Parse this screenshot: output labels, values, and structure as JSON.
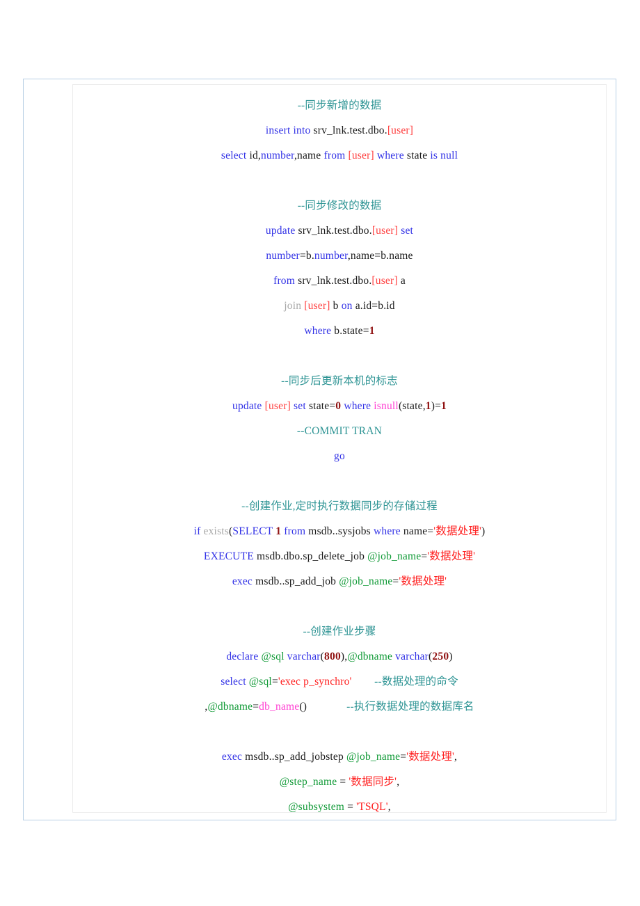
{
  "document": {
    "type": "sql-code-listing",
    "language": "T-SQL",
    "alignment": "center",
    "colors": {
      "page_border": "#b8cfe5",
      "content_border": "#ececec",
      "background": "#ffffff",
      "plain": "#1a1a1a",
      "keyword": "#3232e6",
      "comment": "#2e9494",
      "bracket": "#ff4040",
      "string": "#ff2020",
      "number": "#8f1111",
      "variable": "#119a37",
      "function": "#ff3fd2",
      "dim": "#a8a8a8"
    }
  },
  "lines": [
    {
      "id": "l1",
      "tokens": [
        {
          "t": "--同步新增的数据",
          "c": "comment"
        }
      ]
    },
    {
      "id": "l2",
      "tokens": [
        {
          "t": "insert into",
          "c": "keyword"
        },
        {
          "t": " srv_lnk.test.dbo.",
          "c": "plain"
        },
        {
          "t": "[user]",
          "c": "bracket"
        }
      ]
    },
    {
      "id": "l3",
      "tokens": [
        {
          "t": "select",
          "c": "keyword"
        },
        {
          "t": " id,",
          "c": "plain"
        },
        {
          "t": "number",
          "c": "keyword"
        },
        {
          "t": ",name ",
          "c": "plain"
        },
        {
          "t": "from",
          "c": "keyword"
        },
        {
          "t": " ",
          "c": "plain"
        },
        {
          "t": "[user]",
          "c": "bracket"
        },
        {
          "t": " ",
          "c": "plain"
        },
        {
          "t": "where",
          "c": "keyword"
        },
        {
          "t": " state ",
          "c": "plain"
        },
        {
          "t": "is null",
          "c": "keyword"
        }
      ]
    },
    {
      "id": "l4",
      "tokens": []
    },
    {
      "id": "l5",
      "tokens": [
        {
          "t": "--同步修改的数据",
          "c": "comment"
        }
      ]
    },
    {
      "id": "l6",
      "tokens": [
        {
          "t": "update",
          "c": "keyword"
        },
        {
          "t": " srv_lnk.test.dbo.",
          "c": "plain"
        },
        {
          "t": "[user]",
          "c": "bracket"
        },
        {
          "t": " ",
          "c": "plain"
        },
        {
          "t": "set",
          "c": "keyword"
        }
      ]
    },
    {
      "id": "l7",
      "tokens": [
        {
          "t": "number",
          "c": "keyword"
        },
        {
          "t": "=b.",
          "c": "plain"
        },
        {
          "t": "number",
          "c": "keyword"
        },
        {
          "t": ",name=b.name",
          "c": "plain"
        }
      ]
    },
    {
      "id": "l8",
      "tokens": [
        {
          "t": "from",
          "c": "keyword"
        },
        {
          "t": " srv_lnk.test.dbo.",
          "c": "plain"
        },
        {
          "t": "[user]",
          "c": "bracket"
        },
        {
          "t": " a",
          "c": "plain"
        }
      ]
    },
    {
      "id": "l9",
      "tokens": [
        {
          "t": "join",
          "c": "dim"
        },
        {
          "t": " ",
          "c": "plain"
        },
        {
          "t": "[user]",
          "c": "bracket"
        },
        {
          "t": " b ",
          "c": "plain"
        },
        {
          "t": "on",
          "c": "keyword"
        },
        {
          "t": " a.id=b.id",
          "c": "plain"
        }
      ]
    },
    {
      "id": "l10",
      "tokens": [
        {
          "t": "where",
          "c": "keyword"
        },
        {
          "t": " b.state=",
          "c": "plain"
        },
        {
          "t": "1",
          "c": "number"
        }
      ]
    },
    {
      "id": "l11",
      "tokens": []
    },
    {
      "id": "l12",
      "tokens": [
        {
          "t": "--同步后更新本机的标志",
          "c": "comment"
        }
      ]
    },
    {
      "id": "l13",
      "tokens": [
        {
          "t": "update",
          "c": "keyword"
        },
        {
          "t": " ",
          "c": "plain"
        },
        {
          "t": "[user]",
          "c": "bracket"
        },
        {
          "t": " ",
          "c": "plain"
        },
        {
          "t": "set",
          "c": "keyword"
        },
        {
          "t": " state=",
          "c": "plain"
        },
        {
          "t": "0",
          "c": "number"
        },
        {
          "t": " ",
          "c": "plain"
        },
        {
          "t": "where",
          "c": "keyword"
        },
        {
          "t": " ",
          "c": "plain"
        },
        {
          "t": "isnull",
          "c": "func"
        },
        {
          "t": "(state,",
          "c": "plain"
        },
        {
          "t": "1",
          "c": "number"
        },
        {
          "t": ")=",
          "c": "plain"
        },
        {
          "t": "1",
          "c": "number"
        }
      ]
    },
    {
      "id": "l14",
      "tokens": [
        {
          "t": "--COMMIT TRAN",
          "c": "comment"
        }
      ]
    },
    {
      "id": "l15",
      "tokens": [
        {
          "t": "go",
          "c": "keyword"
        }
      ]
    },
    {
      "id": "l16",
      "tokens": []
    },
    {
      "id": "l17",
      "tokens": [
        {
          "t": "--创建作业,定时执行数据同步的存储过程",
          "c": "comment"
        }
      ]
    },
    {
      "id": "l18",
      "tokens": [
        {
          "t": "if",
          "c": "keyword"
        },
        {
          "t": " ",
          "c": "plain"
        },
        {
          "t": "exists",
          "c": "dim"
        },
        {
          "t": "(",
          "c": "plain"
        },
        {
          "t": "SELECT",
          "c": "keyword"
        },
        {
          "t": " ",
          "c": "plain"
        },
        {
          "t": "1",
          "c": "number"
        },
        {
          "t": " ",
          "c": "plain"
        },
        {
          "t": "from",
          "c": "keyword"
        },
        {
          "t": " msdb..sysjobs ",
          "c": "plain"
        },
        {
          "t": "where",
          "c": "keyword"
        },
        {
          "t": " name=",
          "c": "plain"
        },
        {
          "t": "'数据处理'",
          "c": "string"
        },
        {
          "t": ")",
          "c": "plain"
        }
      ]
    },
    {
      "id": "l19",
      "tokens": [
        {
          "t": "EXECUTE",
          "c": "keyword"
        },
        {
          "t": " msdb.dbo.sp_delete_job ",
          "c": "plain"
        },
        {
          "t": "@job_name",
          "c": "var"
        },
        {
          "t": "=",
          "c": "plain"
        },
        {
          "t": "'数据处理'",
          "c": "string"
        }
      ]
    },
    {
      "id": "l20",
      "tokens": [
        {
          "t": "exec",
          "c": "keyword"
        },
        {
          "t": " msdb..sp_add_job ",
          "c": "plain"
        },
        {
          "t": "@job_name",
          "c": "var"
        },
        {
          "t": "=",
          "c": "plain"
        },
        {
          "t": "'数据处理'",
          "c": "string"
        }
      ]
    },
    {
      "id": "l21",
      "tokens": []
    },
    {
      "id": "l22",
      "tokens": [
        {
          "t": "--创建作业步骤",
          "c": "comment"
        }
      ]
    },
    {
      "id": "l23",
      "tokens": [
        {
          "t": "declare",
          "c": "keyword"
        },
        {
          "t": " ",
          "c": "plain"
        },
        {
          "t": "@sql",
          "c": "var"
        },
        {
          "t": " ",
          "c": "plain"
        },
        {
          "t": "varchar",
          "c": "keyword"
        },
        {
          "t": "(",
          "c": "plain"
        },
        {
          "t": "800",
          "c": "number"
        },
        {
          "t": "),",
          "c": "plain"
        },
        {
          "t": "@dbname",
          "c": "var"
        },
        {
          "t": " ",
          "c": "plain"
        },
        {
          "t": "varchar",
          "c": "keyword"
        },
        {
          "t": "(",
          "c": "plain"
        },
        {
          "t": "250",
          "c": "number"
        },
        {
          "t": ")",
          "c": "plain"
        }
      ]
    },
    {
      "id": "l24",
      "tokens": [
        {
          "t": "select",
          "c": "keyword"
        },
        {
          "t": " ",
          "c": "plain"
        },
        {
          "t": "@sql",
          "c": "var"
        },
        {
          "t": "=",
          "c": "plain"
        },
        {
          "t": "'exec p_synchro'",
          "c": "string"
        },
        {
          "t": "        ",
          "c": "plain"
        },
        {
          "t": "--数据处理的命令",
          "c": "comment"
        }
      ]
    },
    {
      "id": "l25",
      "tokens": [
        {
          "t": ",",
          "c": "plain"
        },
        {
          "t": "@dbname",
          "c": "var"
        },
        {
          "t": "=",
          "c": "plain"
        },
        {
          "t": "db_name",
          "c": "func"
        },
        {
          "t": "()",
          "c": "plain"
        },
        {
          "t": "              ",
          "c": "plain"
        },
        {
          "t": "--执行数据处理的数据库名",
          "c": "comment"
        }
      ]
    },
    {
      "id": "l26",
      "tokens": []
    },
    {
      "id": "l27",
      "tokens": [
        {
          "t": "exec",
          "c": "keyword"
        },
        {
          "t": " msdb..sp_add_jobstep ",
          "c": "plain"
        },
        {
          "t": "@job_name",
          "c": "var"
        },
        {
          "t": "=",
          "c": "plain"
        },
        {
          "t": "'数据处理'",
          "c": "string"
        },
        {
          "t": ",",
          "c": "plain"
        }
      ]
    },
    {
      "id": "l28",
      "tokens": [
        {
          "t": "@step_name",
          "c": "var"
        },
        {
          "t": " = ",
          "c": "plain"
        },
        {
          "t": "'数据同步'",
          "c": "string"
        },
        {
          "t": ",",
          "c": "plain"
        }
      ]
    },
    {
      "id": "l29",
      "tokens": [
        {
          "t": "@subsystem",
          "c": "var"
        },
        {
          "t": " = ",
          "c": "plain"
        },
        {
          "t": "'TSQL'",
          "c": "string"
        },
        {
          "t": ",",
          "c": "plain"
        }
      ]
    }
  ]
}
